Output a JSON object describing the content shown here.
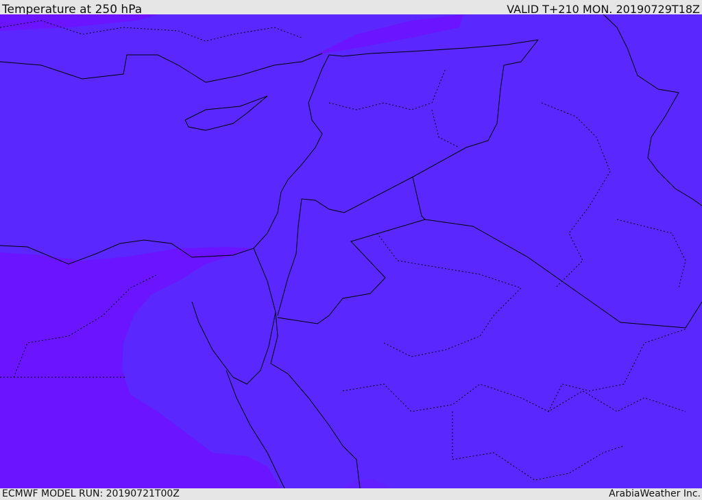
{
  "header": {
    "title": "Temperature at 250 hPa",
    "valid": "VALID T+210 MON. 20190729T18Z"
  },
  "footer": {
    "model_run": "ECMWF MODEL RUN: 20190721T00Z",
    "credit": "ArabiaWeather Inc."
  },
  "map": {
    "field": "temperature-250hPa",
    "colors": {
      "main": "#5a28ff",
      "cold": "#6a14ff",
      "mid": "#6320ff",
      "lines": "#000000"
    }
  }
}
